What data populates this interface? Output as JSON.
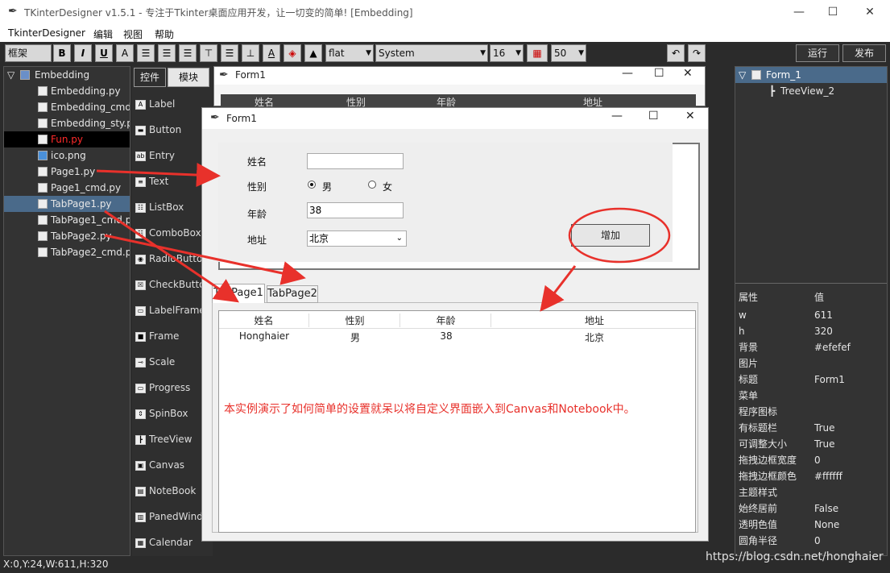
{
  "window": {
    "title": "TKinterDesigner v1.5.1 - 专注于Tkinter桌面应用开发，让一切变的简单!   [Embedding]",
    "minimize": "—",
    "maximize": "☐",
    "close": "✕"
  },
  "menu": [
    "TkinterDesigner",
    "编辑",
    "视图",
    "帮助"
  ],
  "toolbar": {
    "frame_label": "框架",
    "bold": "B",
    "italic": "I",
    "underline": "U",
    "text_a": "A",
    "relief_value": "flat",
    "font_value": "System",
    "size_value": "16",
    "grid_value": "50",
    "run_label": "运行",
    "publish_label": "发布"
  },
  "file_tree": {
    "root": "Embedding",
    "items": [
      "Embedding.py",
      "Embedding_cmd.",
      "Embedding_sty.p",
      "Fun.py",
      "ico.png",
      "Page1.py",
      "Page1_cmd.py",
      "TabPage1.py",
      "TabPage1_cmd.p",
      "TabPage2.py",
      "TabPage2_cmd.p"
    ],
    "selected": "TabPage1.py",
    "highlight": "Fun.py"
  },
  "widget_panel": {
    "tabs": [
      "控件",
      "模块"
    ],
    "items": [
      {
        "icon": "A",
        "label": "Label"
      },
      {
        "icon": "▬",
        "label": "Button"
      },
      {
        "icon": "ab",
        "label": "Entry"
      },
      {
        "icon": "≡",
        "label": "Text"
      },
      {
        "icon": "☷",
        "label": "ListBox"
      },
      {
        "icon": "☷",
        "label": "ComboBox"
      },
      {
        "icon": "◉",
        "label": "RadioButto"
      },
      {
        "icon": "☒",
        "label": "CheckButto"
      },
      {
        "icon": "▭",
        "label": "LabelFrame"
      },
      {
        "icon": "■",
        "label": "Frame"
      },
      {
        "icon": "⊸",
        "label": "Scale"
      },
      {
        "icon": "▭",
        "label": "Progress"
      },
      {
        "icon": "⇕",
        "label": "SpinBox"
      },
      {
        "icon": "┣",
        "label": "TreeView"
      },
      {
        "icon": "▣",
        "label": "Canvas"
      },
      {
        "icon": "▤",
        "label": "NoteBook"
      },
      {
        "icon": "▥",
        "label": "PanedWind"
      },
      {
        "icon": "▦",
        "label": "Calendar"
      }
    ]
  },
  "back_form": {
    "title": "Form1",
    "columns": [
      "姓名",
      "性别",
      "年龄",
      "地址"
    ]
  },
  "front_form": {
    "title": "Form1",
    "name_label": "姓名",
    "gender_label": "性别",
    "male": "男",
    "female": "女",
    "age_label": "年龄",
    "age_value": "38",
    "address_label": "地址",
    "address_value": "北京",
    "add_button": "增加",
    "tabs": [
      "TabPage1",
      "TabPage2"
    ],
    "table": {
      "columns": [
        "姓名",
        "性别",
        "年龄",
        "地址"
      ],
      "rows": [
        [
          "Honghaier",
          "男",
          "38",
          "北京"
        ]
      ]
    },
    "annotation": "本实例演示了如何简单的设置就呆以将自定义界面嵌入到Canvas和Notebook中。"
  },
  "object_tree": {
    "root": "Form_1",
    "child": "TreeView_2"
  },
  "properties": {
    "header": [
      "属性",
      "值"
    ],
    "rows": [
      [
        "w",
        "611"
      ],
      [
        "h",
        "320"
      ],
      [
        "背景",
        "#efefef"
      ],
      [
        "图片",
        ""
      ],
      [
        "标题",
        "Form1"
      ],
      [
        "菜单",
        ""
      ],
      [
        "程序图标",
        ""
      ],
      [
        "有标题栏",
        "True"
      ],
      [
        "可调整大小",
        "True"
      ],
      [
        "拖拽边框宽度",
        "0"
      ],
      [
        "拖拽边框颜色",
        "#ffffff"
      ],
      [
        "主题样式",
        ""
      ],
      [
        "始终居前",
        "False"
      ],
      [
        "透明色值",
        "None"
      ],
      [
        "圆角半径",
        "0"
      ]
    ]
  },
  "status_text": "X:0,Y:24,W:611,H:320",
  "watermark": "https://blog.csdn.net/honghaier",
  "colors": {
    "annotation": "#e8312b",
    "arrow": "#e8312b",
    "selected_row": "#4a6a8a"
  }
}
